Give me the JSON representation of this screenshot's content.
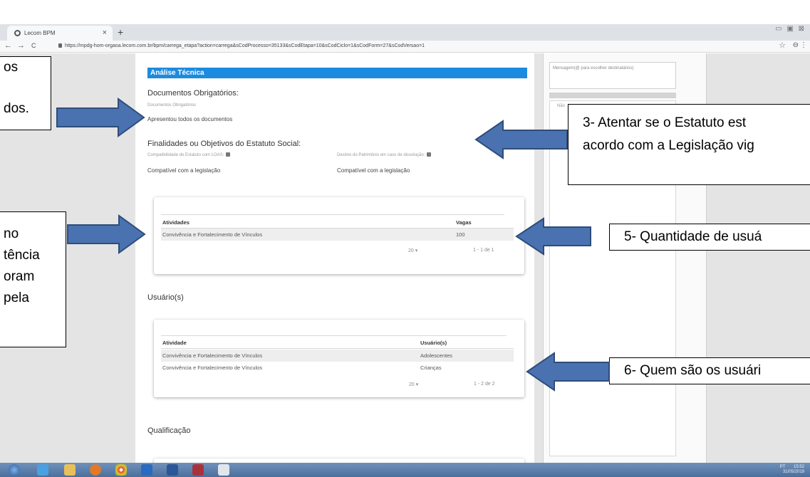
{
  "browser": {
    "tab_title": "Lecom BPM",
    "tab_close": "×",
    "new_tab": "+",
    "window_controls": "▭ ▣ ⊠",
    "back": "←",
    "forward": "→",
    "reload": "C",
    "url": "https://mpdg-hom-orgaoa.lecom.com.br/bpm/carrega_etapa?action=carrega&sCodProcesso=35133&sCodEtapa=10&sCodCiclo=1&sCodForm=27&sCodVersao=1",
    "bookmark_icon": "☆",
    "account_icon": "⊖",
    "menu_icon": "⋮"
  },
  "form": {
    "section_title": "Análise Técnica",
    "docs_heading": "Documentos Obrigatórios:",
    "docs_field_label": "Documentos Obrigatórios",
    "docs_value": "Apresentou todos os documentos",
    "finalidades_heading": "Finalidades ou Objetivos do Estatuto Social:",
    "compat_label": "Compatibilidade do Estatuto com LOAS:",
    "compat_value": "Compatível com a legislação",
    "destino_label": "Destino do Patrimônio em caso de dissolução:",
    "destino_value": "Compatível com a legislação",
    "atividades_table": {
      "headers": [
        "Atividades",
        "Vagas"
      ],
      "rows": [
        [
          "Convivência e Fortalecimento de Vínculos",
          "100"
        ]
      ],
      "page_size": "20 ▾",
      "range": "1 - 1 de 1"
    },
    "usuarios_heading": "Usuário(s)",
    "usuarios_table": {
      "headers": [
        "Atividade",
        "Usuário(s)"
      ],
      "rows": [
        [
          "Convivência e Fortalecimento de Vínculos",
          "Adolescentes"
        ],
        [
          "Convivência e Fortalecimento de Vínculos",
          "Crianças"
        ]
      ],
      "page_size": "20 ▾",
      "range": "1 - 2 de 2"
    },
    "qualificacao_heading": "Qualificação"
  },
  "sidebar": {
    "message_placeholder": "Mensagem(@ para escolher destinatários)",
    "panel_fragment": "Não"
  },
  "callouts": {
    "c1_line1": "os",
    "c1_line2": "",
    "c1_line3": "dos.",
    "c2_lines": [
      "no",
      "tência",
      "oram",
      "pela"
    ],
    "c3_line1": "3- Atentar se o Estatuto est",
    "c3_line2": "acordo com a Legislação vig",
    "c5": "5- Quantidade de usuá",
    "c6": "6- Quem são os usuári"
  },
  "taskbar": {
    "tray_lang": "PT",
    "tray_time": "15:52",
    "tray_date": "31/05/2019"
  },
  "colors": {
    "section_header": "#1b8be0",
    "arrow_fill": "#4a72b0",
    "arrow_stroke": "#2e4d7a"
  }
}
